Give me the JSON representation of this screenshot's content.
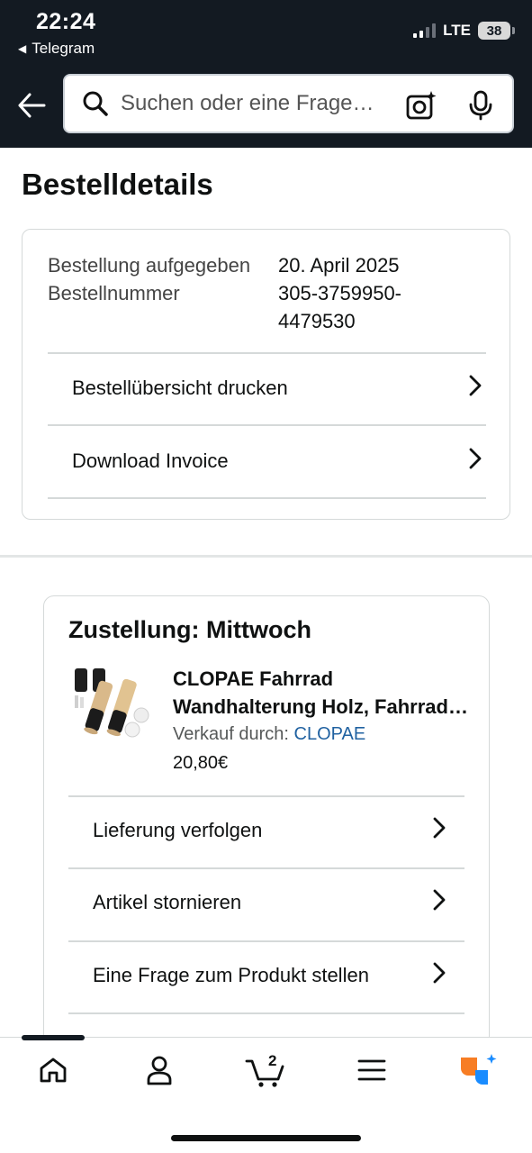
{
  "status_bar": {
    "time": "22:24",
    "back_app": "Telegram",
    "network": "LTE",
    "battery": "38"
  },
  "search": {
    "placeholder": "Suchen oder eine Frage…"
  },
  "page": {
    "title": "Bestelldetails"
  },
  "order_info": {
    "placed_label": "Bestellung aufgegeben",
    "placed_value": "20. April 2025",
    "number_label": "Bestellnummer",
    "number_value": "305-3759950-\n4479530"
  },
  "order_actions": [
    {
      "label": "Bestellübersicht drucken"
    },
    {
      "label": "Download Invoice"
    }
  ],
  "shipment": {
    "title": "Zustellung: Mittwoch",
    "product": {
      "title_line1": "CLOPAE Fahrrad",
      "title_line2": "Wandhalterung Holz, Fahrrad Wandhalterung",
      "seller_label": "Verkauf durch:",
      "seller_name": "CLOPAE",
      "price": "20,80€"
    },
    "actions": [
      {
        "label": "Lieferung verfolgen"
      },
      {
        "label": "Artikel stornieren"
      },
      {
        "label": "Eine Frage zum Produkt stellen"
      }
    ]
  },
  "bottom_nav": {
    "cart_count": "2",
    "items": [
      "home-icon",
      "account-icon",
      "cart-icon",
      "menu-icon",
      "rufus-icon"
    ],
    "active": "home"
  },
  "colors": {
    "header_bg": "#131a22",
    "link": "#2162a1",
    "rufus_orange": "#f77d24",
    "rufus_blue": "#1a8cff"
  }
}
